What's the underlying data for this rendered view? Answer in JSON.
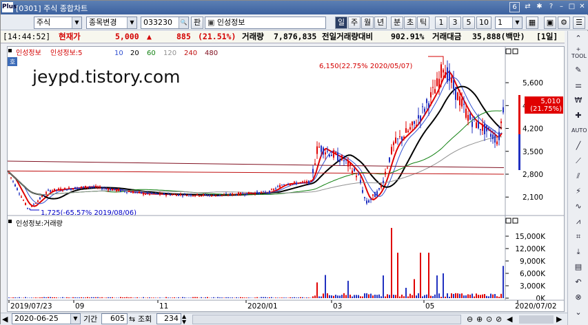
{
  "window": {
    "logo": "Plus",
    "title": "[0301] 주식 종합차트",
    "screen_num": "6"
  },
  "toolbar": {
    "market": "주식",
    "change_label": "종목변경",
    "code": "033230",
    "search_icon": "search-icon",
    "pan_label": "판",
    "stock_name": "인성정보",
    "periods": [
      "일",
      "주",
      "월",
      "년",
      "분",
      "초",
      "틱"
    ],
    "period_active": "일",
    "numbers": [
      "1",
      "3",
      "5",
      "10"
    ],
    "count_value": "1"
  },
  "info": {
    "time": "[14:44:52]",
    "cur_label": "현재가",
    "price": "5,000",
    "arrow": "▲",
    "change": "885",
    "change_pct": "(21.51%)",
    "vol_label": "거래량",
    "volume": "7,876,835",
    "prev_label": "전일거래량대비",
    "prev_pct": "902.91%",
    "amount_label": "거래대금",
    "amount": "35,888(백만)",
    "period_badge": "[1일]"
  },
  "chart": {
    "watermark": "jeypd.tistory.com",
    "badge": "호",
    "legend": {
      "name": "인성정보",
      "ma_name": "인성정보:5",
      "mas": [
        {
          "v": "10",
          "c": "#3050d0"
        },
        {
          "v": "20",
          "c": "#000000"
        },
        {
          "v": "60",
          "c": "#108010"
        },
        {
          "v": "120",
          "c": "#909090"
        },
        {
          "v": "240",
          "c": "#c01010"
        },
        {
          "v": "480",
          "c": "#801020"
        }
      ]
    },
    "high_note": "6,150(22.75% 2020/05/07)",
    "low_note": "1,725(-65.57% 2019/08/06)",
    "price_ticks": [
      "5,600",
      "4,900",
      "4,200",
      "3,500",
      "2,800",
      "2,100"
    ],
    "current_box": [
      "5,010",
      "(21.75%)"
    ],
    "volume_legend": "인성정보:거래량",
    "volume_ticks": [
      "15,000K",
      "12,000K",
      "9,000K",
      "6,000K",
      "3,000K",
      "0K"
    ],
    "dates": [
      "2019/07/23",
      "09",
      "11",
      "2020/01",
      "03",
      "05",
      "2020/07/02"
    ]
  },
  "bottom": {
    "date": "2020-06-25",
    "period_label": "기간",
    "period_value": "605",
    "query_label": "조회",
    "query_value": "234"
  },
  "chart_data": {
    "type": "line",
    "title": "",
    "x": [
      "2019/07/23",
      "2019/08/06",
      "2019/09",
      "2019/11",
      "2020/01",
      "2020/03",
      "2020/05/07",
      "2020/06/25"
    ],
    "series": [
      {
        "name": "인성정보",
        "values": [
          2900,
          1725,
          2400,
          2150,
          2250,
          2550,
          6150,
          5000
        ]
      }
    ],
    "ylim": [
      1725,
      6150
    ]
  }
}
